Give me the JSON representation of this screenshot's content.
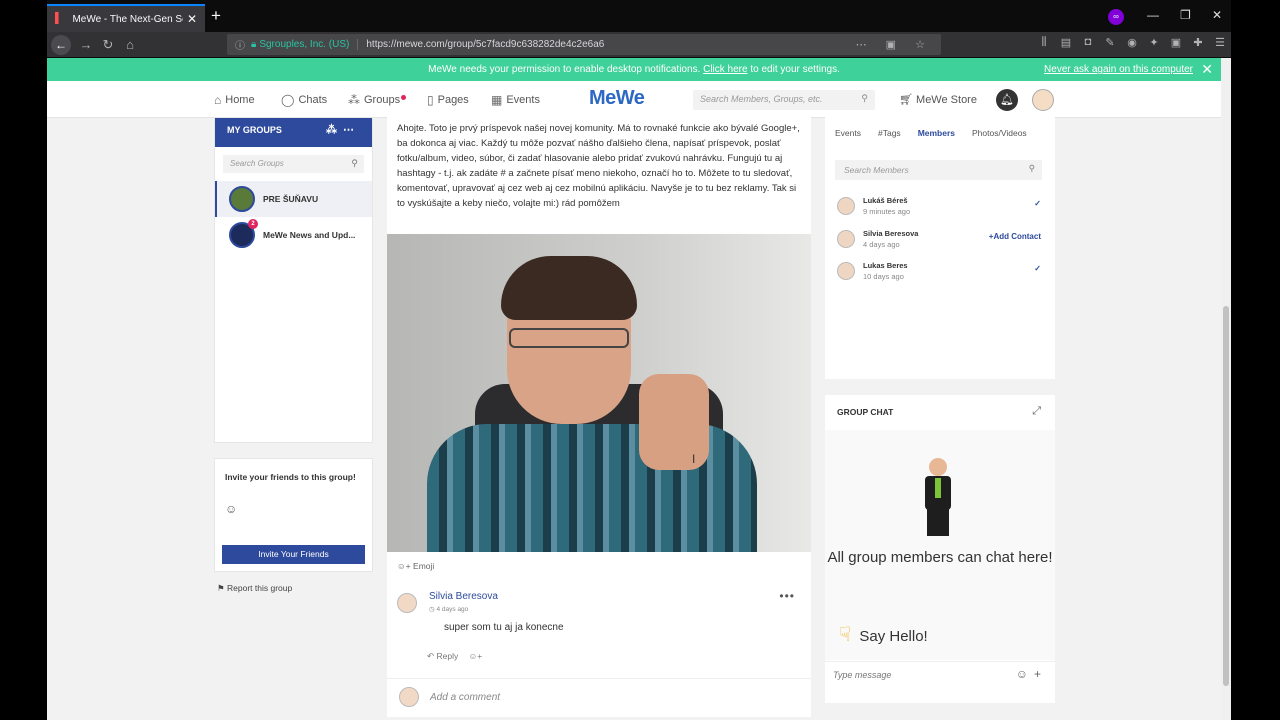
{
  "browser": {
    "tab_title": "MeWe - The Next-Gen Social N",
    "url_org": "Sgrouples, Inc. (US)",
    "url": "https://mewe.com/group/5c7facd9c638282de4c2e6a6"
  },
  "notification": {
    "text": "MeWe needs your permission to enable desktop notifications.",
    "link": "Click here",
    "suffix": "to edit your settings.",
    "never": "Never ask again on this computer"
  },
  "header": {
    "nav": [
      "Home",
      "Chats",
      "Groups",
      "Pages",
      "Events"
    ],
    "logo": "MeWe",
    "search_placeholder": "Search Members, Groups, etc.",
    "store": "MeWe Store"
  },
  "sidebar": {
    "title": "MY GROUPS",
    "search_placeholder": "Search Groups",
    "groups": [
      {
        "name": "PRE ŠUŇAVU"
      },
      {
        "name": "MeWe News and Upd...",
        "badge": "2"
      }
    ],
    "invite_title": "Invite your friends to this group!",
    "invite_button": "Invite Your Friends",
    "report": "Report this group"
  },
  "post": {
    "text": "Ahojte. Toto je prvý príspevok našej novej komunity. Má to rovnaké funkcie ako bývalé Google+, ba dokonca aj viac. Každý tu môže pozvať nášho ďalšieho člena, napísať príspevok, poslať fotku/album, video, súbor, či zadať hlasovanie alebo pridať zvukovú nahrávku. Fungujú tu aj hashtagy - t.j. ak zadáte # a začnete písať meno niekoho, označí ho to. Môžete to tu sledovať, komentovať, upravovať aj cez web aj cez mobilnú aplikáciu. Navyše je to tu bez reklamy. Tak si to vyskúšajte a keby niečo, volajte mi:) rád pomôžem",
    "emoji_label": "Emoji",
    "comment": {
      "author": "Silvia Beresova",
      "time": "4 days ago",
      "text": "super som tu aj ja konecne",
      "reply": "Reply"
    },
    "add_comment_placeholder": "Add a comment"
  },
  "members": {
    "tabs": [
      "Events",
      "#Tags",
      "Members",
      "Photos/Videos"
    ],
    "active_tab": "Members",
    "search_placeholder": "Search Members",
    "list": [
      {
        "name": "Lukáš Béreš",
        "time": "9 minutes ago",
        "action": "✓"
      },
      {
        "name": "Silvia Beresova",
        "time": "4 days ago",
        "action": "+Add Contact"
      },
      {
        "name": "Lukas Beres",
        "time": "10 days ago",
        "action": "✓"
      }
    ]
  },
  "group_chat": {
    "title": "GROUP CHAT",
    "message": "All group members can chat here!",
    "say_hello": "Say Hello!",
    "input_placeholder": "Type message"
  },
  "colors": {
    "accent": "#2d4a9c",
    "banner": "#3fd19a"
  }
}
